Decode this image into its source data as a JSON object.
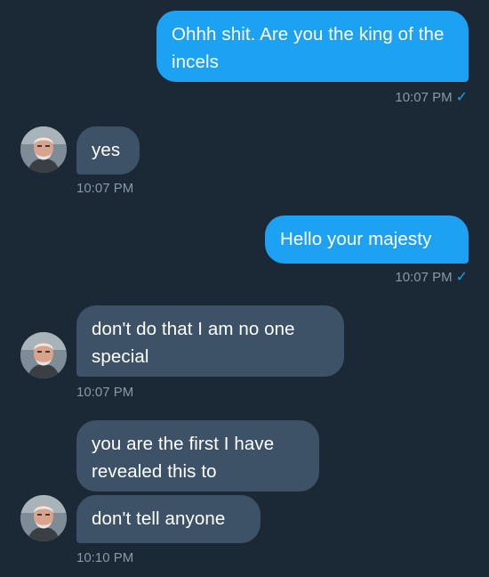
{
  "messages": [
    {
      "direction": "outgoing",
      "text": "Ohhh shit. Are you the king of the incels",
      "time": "10:07 PM",
      "read_icon": "checkmark-icon"
    },
    {
      "direction": "incoming",
      "text": "yes",
      "time": "10:07 PM"
    },
    {
      "direction": "outgoing",
      "text": "Hello your majesty",
      "time": "10:07 PM",
      "read_icon": "checkmark-icon"
    },
    {
      "direction": "incoming",
      "text": "don't do that I am no one special",
      "time": "10:07 PM"
    },
    {
      "direction": "incoming",
      "text": "you are the first I have revealed this to"
    },
    {
      "direction": "incoming",
      "text": "don't tell anyone",
      "time": "10:10 PM"
    }
  ],
  "check_glyph": "✓",
  "colors": {
    "background": "#1b2836",
    "outgoing_bubble": "#1da1f2",
    "incoming_bubble": "#3d5266",
    "timestamp": "#8899a6",
    "check": "#1da1f2"
  }
}
